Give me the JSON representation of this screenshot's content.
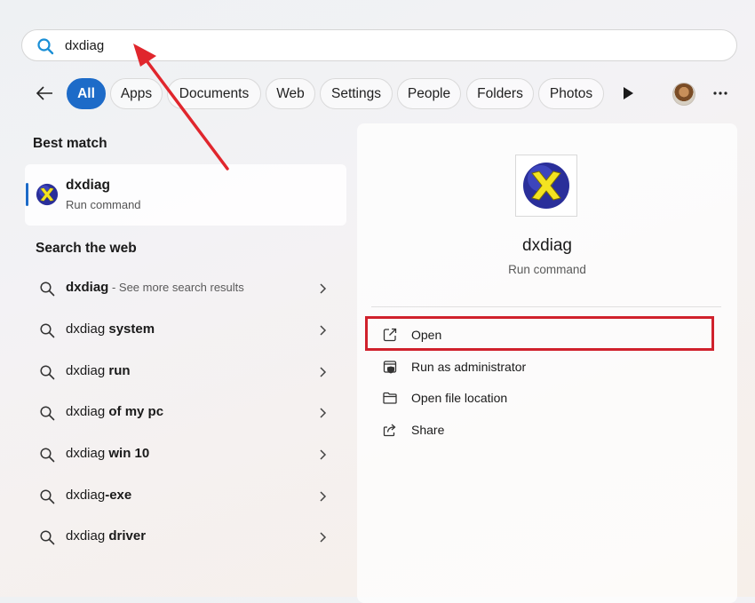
{
  "search": {
    "query": "dxdiag"
  },
  "filters": {
    "back_label": "Back",
    "chips": [
      "All",
      "Apps",
      "Documents",
      "Web",
      "Settings",
      "People",
      "Folders",
      "Photos"
    ],
    "active": "All"
  },
  "best_match": {
    "section_title": "Best match",
    "name": "dxdiag",
    "type": "Run command"
  },
  "web": {
    "section_title": "Search the web",
    "items": [
      {
        "prefix": "dxdiag",
        "bold": "",
        "suffix": " - See more search results"
      },
      {
        "prefix": "dxdiag ",
        "bold": "system",
        "suffix": ""
      },
      {
        "prefix": "dxdiag ",
        "bold": "run",
        "suffix": ""
      },
      {
        "prefix": "dxdiag ",
        "bold": "of my pc",
        "suffix": ""
      },
      {
        "prefix": "dxdiag ",
        "bold": "win 10",
        "suffix": ""
      },
      {
        "prefix": "dxdiag",
        "bold": "-exe",
        "suffix": ""
      },
      {
        "prefix": "dxdiag ",
        "bold": "driver",
        "suffix": ""
      }
    ]
  },
  "detail": {
    "name": "dxdiag",
    "type": "Run command",
    "actions": [
      {
        "label": "Open",
        "icon": "open-external-icon"
      },
      {
        "label": "Run as administrator",
        "icon": "shield-admin-icon"
      },
      {
        "label": "Open file location",
        "icon": "folder-icon"
      },
      {
        "label": "Share",
        "icon": "share-icon"
      }
    ]
  },
  "colors": {
    "accent": "#1d6bc8",
    "highlight": "#d0212c",
    "annotation_arrow": "#e0262d"
  }
}
